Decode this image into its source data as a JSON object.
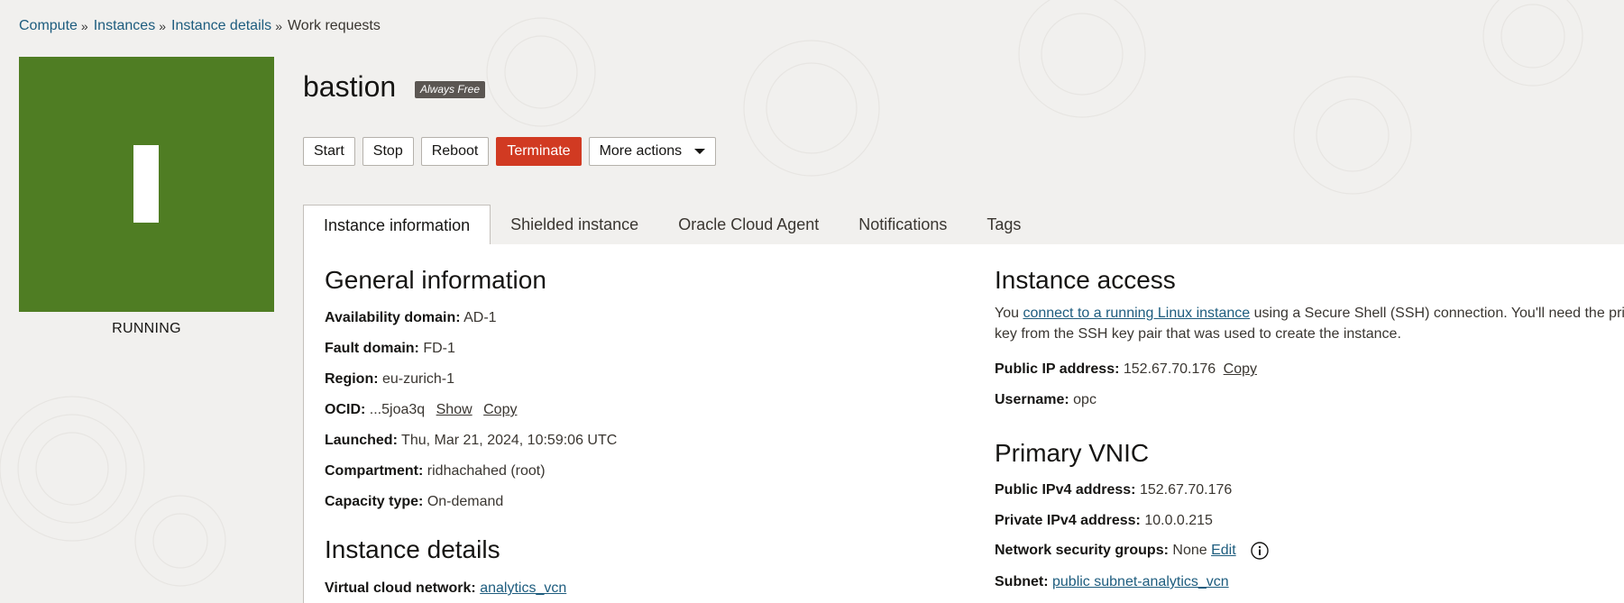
{
  "breadcrumb": {
    "items": [
      "Compute",
      "Instances",
      "Instance details"
    ],
    "current": "Work requests",
    "separator": "»"
  },
  "status": {
    "label": "RUNNING",
    "color": "#4f7d23"
  },
  "instance": {
    "name": "bastion",
    "badge": "Always Free"
  },
  "actions": {
    "start": "Start",
    "stop": "Stop",
    "reboot": "Reboot",
    "terminate": "Terminate",
    "more": "More actions"
  },
  "tabs": [
    {
      "label": "Instance information",
      "active": true
    },
    {
      "label": "Shielded instance",
      "active": false
    },
    {
      "label": "Oracle Cloud Agent",
      "active": false
    },
    {
      "label": "Notifications",
      "active": false
    },
    {
      "label": "Tags",
      "active": false
    }
  ],
  "general": {
    "heading": "General information",
    "availability_domain": {
      "label": "Availability domain:",
      "value": "AD-1"
    },
    "fault_domain": {
      "label": "Fault domain:",
      "value": "FD-1"
    },
    "region": {
      "label": "Region:",
      "value": "eu-zurich-1"
    },
    "ocid": {
      "label": "OCID:",
      "value": "...5joa3q",
      "show": "Show",
      "copy": "Copy"
    },
    "launched": {
      "label": "Launched:",
      "value": "Thu, Mar 21, 2024, 10:59:06 UTC"
    },
    "compartment": {
      "label": "Compartment:",
      "value": "ridhachahed (root)"
    },
    "capacity_type": {
      "label": "Capacity type:",
      "value": "On-demand"
    }
  },
  "details": {
    "heading": "Instance details",
    "vcn": {
      "label": "Virtual cloud network:",
      "value": "analytics_vcn"
    }
  },
  "access": {
    "heading": "Instance access",
    "text_before": "You ",
    "link": "connect to a running Linux instance",
    "text_after_line1": " using a Secure Shell (SSH) connection. You'll need the priva",
    "text_line2": "key from the SSH key pair that was used to create the instance.",
    "public_ip": {
      "label": "Public IP address:",
      "value": "152.67.70.176",
      "copy": "Copy"
    },
    "username": {
      "label": "Username:",
      "value": "opc"
    }
  },
  "vnic": {
    "heading": "Primary VNIC",
    "public_ipv4": {
      "label": "Public IPv4 address:",
      "value": "152.67.70.176"
    },
    "private_ipv4": {
      "label": "Private IPv4 address:",
      "value": "10.0.0.215"
    },
    "nsg": {
      "label": "Network security groups:",
      "value": "None",
      "edit": "Edit",
      "icon": "info-icon"
    },
    "subnet": {
      "label": "Subnet:",
      "value": "public subnet-analytics_vcn"
    }
  },
  "colors": {
    "link": "#1d5c7e",
    "danger": "#d13a22",
    "running": "#4f7d23",
    "page_bg": "#f1f0ee"
  }
}
